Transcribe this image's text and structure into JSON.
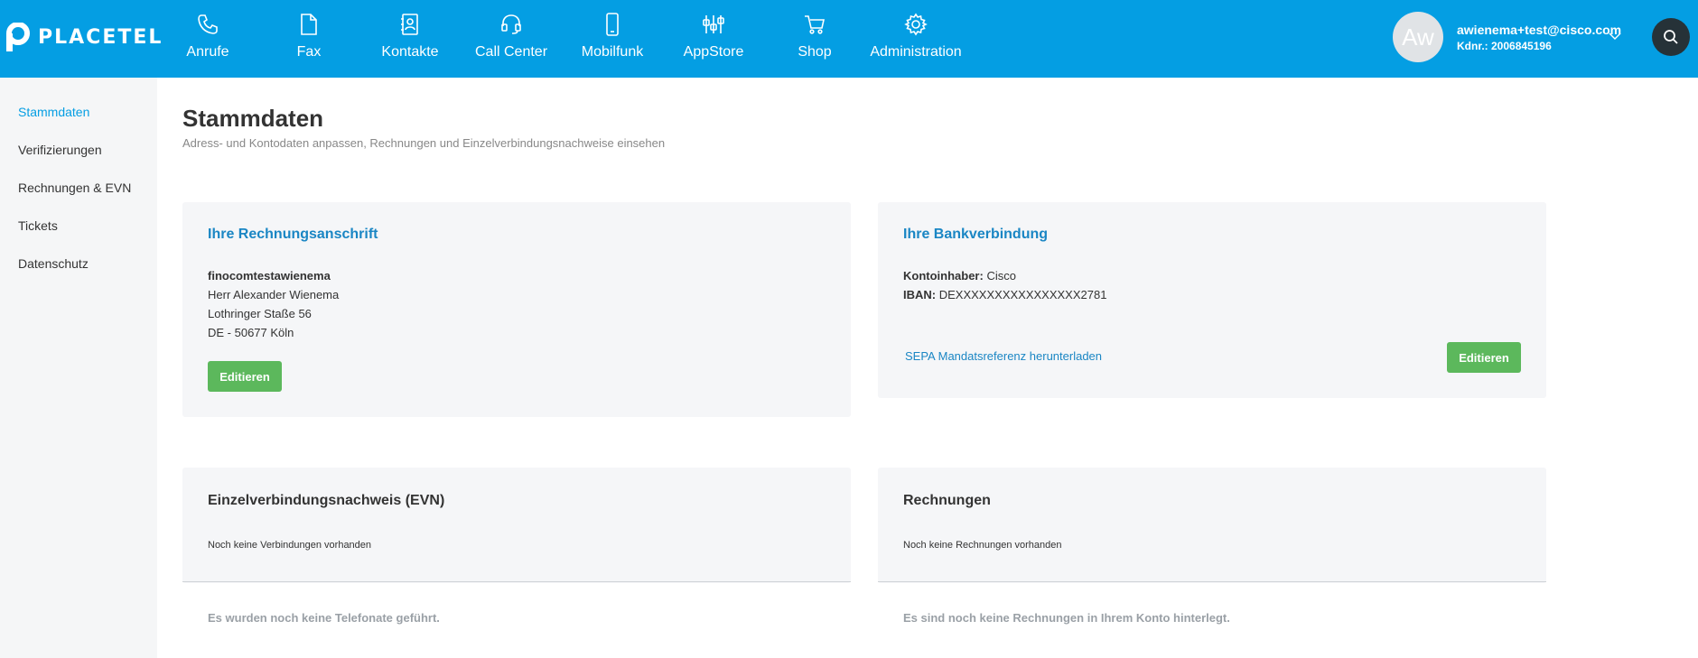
{
  "brand": {
    "name": "PLACETEL"
  },
  "nav": [
    {
      "label": "Anrufe",
      "icon": "phone-icon"
    },
    {
      "label": "Fax",
      "icon": "document-icon"
    },
    {
      "label": "Kontakte",
      "icon": "address-book-icon"
    },
    {
      "label": "Call Center",
      "icon": "headset-icon"
    },
    {
      "label": "Mobilfunk",
      "icon": "mobile-phone-icon"
    },
    {
      "label": "AppStore",
      "icon": "appstore-icon"
    },
    {
      "label": "Shop",
      "icon": "cart-icon"
    },
    {
      "label": "Administration",
      "icon": "gear-icon"
    }
  ],
  "user": {
    "initials": "Aw",
    "email": "awienema+test@cisco.com",
    "customer": "Kdnr.: 2006845196"
  },
  "sidebar": {
    "items": [
      {
        "label": "Stammdaten",
        "active": true
      },
      {
        "label": "Verifizierungen",
        "active": false
      },
      {
        "label": "Rechnungen & EVN",
        "active": false
      },
      {
        "label": "Tickets",
        "active": false
      },
      {
        "label": "Datenschutz",
        "active": false
      }
    ]
  },
  "page": {
    "title": "Stammdaten",
    "subtitle": "Adress- und Kontodaten anpassen, Rechnungen und Einzelverbindungsnachweise einsehen"
  },
  "billing_address": {
    "title": "Ihre Rechnungsanschrift",
    "company": "finocomtestawienema",
    "lines": [
      "Herr Alexander Wienema",
      "Lothringer Staße 56",
      "DE - 50677 Köln"
    ],
    "edit_label": "Editieren"
  },
  "bank": {
    "title": "Ihre Bankverbindung",
    "holder_label": "Kontoinhaber:",
    "holder_value": "Cisco",
    "iban_label": "IBAN:",
    "iban_value": "DEXXXXXXXXXXXXXXXX2781",
    "sepa_link": "SEPA Mandatsreferenz herunterladen",
    "edit_label": "Editieren"
  },
  "evn": {
    "title": "Einzelverbindungsnachweis (EVN)",
    "status": "Noch keine Verbindungen vorhanden",
    "empty": "Es wurden noch keine Telefonate geführt."
  },
  "invoices": {
    "title": "Rechnungen",
    "status": "Noch keine Rechnungen vorhanden",
    "empty": "Es sind noch keine Rechnungen in Ihrem Konto hinterlegt."
  },
  "colors": {
    "brand_blue": "#049ee3",
    "link_blue": "#1a86c4",
    "button_green": "#5cb85c"
  }
}
